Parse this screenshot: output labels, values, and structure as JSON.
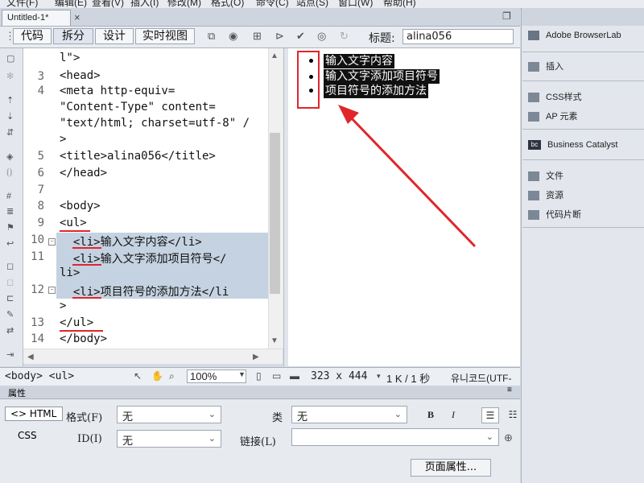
{
  "menubar": {
    "items": [
      "文件(F)",
      "编辑(E)",
      "查看(V)",
      "插入(I)",
      "修改(M)",
      "格式(O)",
      "命令(C)",
      "站点(S)",
      "窗口(W)",
      "帮助(H)"
    ]
  },
  "document": {
    "tab_title": "Untitled-1*",
    "close_glyph": "×"
  },
  "view_buttons": {
    "code": "代码",
    "split": "拆分",
    "design": "设计",
    "live": "实时视图"
  },
  "title_field": {
    "label": "标题:",
    "value": "alina056"
  },
  "code": {
    "lines": [
      {
        "num": "",
        "text": "l\">"
      },
      {
        "num": "3",
        "text": "<head>"
      },
      {
        "num": "4",
        "text": "<meta http-equiv="
      },
      {
        "num": "",
        "text": "\"Content-Type\" content="
      },
      {
        "num": "",
        "text": "\"text/html; charset=utf-8\" /"
      },
      {
        "num": "",
        "text": ">"
      },
      {
        "num": "5",
        "text": "<title>alina056</title>"
      },
      {
        "num": "6",
        "text": "</head>"
      },
      {
        "num": "7",
        "text": ""
      },
      {
        "num": "8",
        "text": "<body>"
      },
      {
        "num": "9",
        "text": "<ul>"
      },
      {
        "num": "10",
        "text": "  <li>输入文字内容</li>"
      },
      {
        "num": "11",
        "text": "  <li>输入文字添加项目符号</"
      },
      {
        "num": "",
        "text": "li>"
      },
      {
        "num": "12",
        "text": "  <li>项目符号的添加方法</li"
      },
      {
        "num": "",
        "text": ">"
      },
      {
        "num": "13",
        "text": "</ul>"
      },
      {
        "num": "14",
        "text": "</body>"
      }
    ]
  },
  "design": {
    "list_items": [
      "输入文字内容",
      "输入文字添加项目符号",
      "项目符号的添加方法"
    ]
  },
  "statusbar": {
    "tag_selector": "<body> <ul>",
    "zoom": "100%",
    "window_size": "323 x 444",
    "file_info": "1 K / 1 秒",
    "encoding": "유니코드(UTF-"
  },
  "properties": {
    "header": "属性",
    "html_button": "<> HTML",
    "css_button": "CSS",
    "format_label": "格式(F)",
    "format_value": "无",
    "class_label": "类",
    "class_value": "无",
    "id_label": "ID(I)",
    "id_value": "无",
    "link_label": "链接(L)",
    "link_value": "",
    "bold": "B",
    "italic": "I",
    "page_props_button": "页面属性..."
  },
  "rightpanel": {
    "items": [
      "Adobe BrowserLab",
      "插入",
      "CSS样式",
      "AP 元素",
      "Business Catalyst",
      "文件",
      "资源",
      "代码片断"
    ]
  },
  "colors": {
    "annotation_red": "#e0262b",
    "selection_blue": "#c5d2e1"
  }
}
